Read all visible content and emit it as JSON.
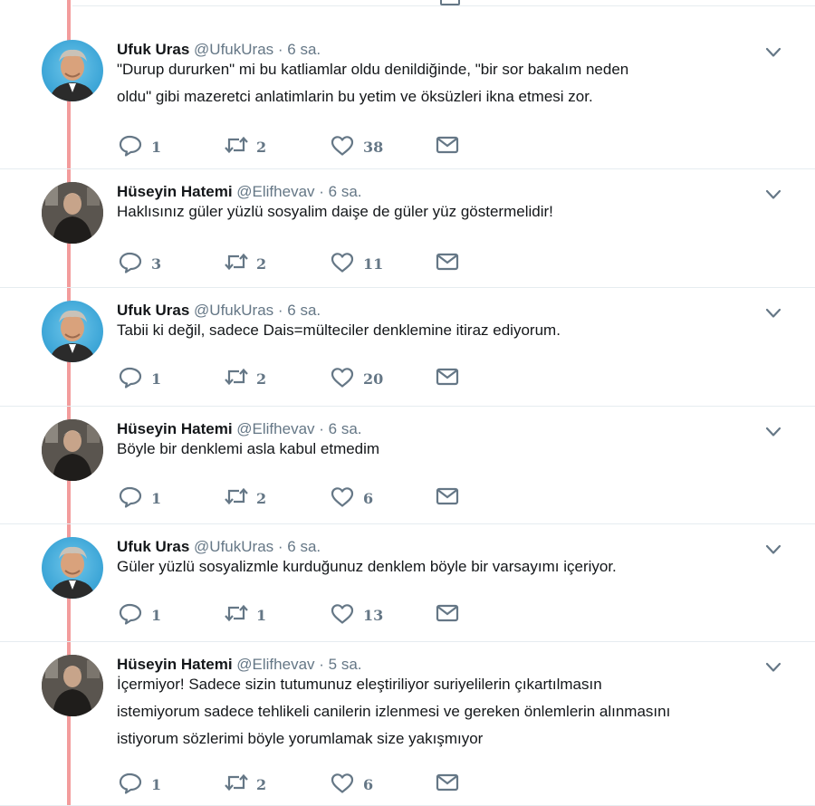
{
  "colors": {
    "thread_line": "#f39c9c",
    "secondary_text": "#657786",
    "primary_text": "#14171a",
    "divider": "#e6ecf0"
  },
  "icons": {
    "reply": "reply-icon",
    "retweet": "retweet-icon",
    "like": "heart-icon",
    "dm": "envelope-icon",
    "menu": "chevron-down-icon"
  },
  "tweets": [
    {
      "name": "Ufuk Uras",
      "handle": "@UfukUras",
      "separator": "·",
      "time": "6 sa.",
      "text": "\"Durup dururken\" mi bu katliamlar oldu  denildiğinde, \"bir sor bakalım neden\noldu\" gibi mazeretci anlatimlarin bu yetim ve öksüzleri ikna etmesi zor.",
      "replies": "1",
      "retweets": "2",
      "likes": "38"
    },
    {
      "name": "Hüseyin Hatemi",
      "handle": "@Elifhevav",
      "separator": "·",
      "time": "6 sa.",
      "text": "Haklısınız güler yüzlü sosyalim daişe de güler yüz göstermelidir!",
      "replies": "3",
      "retweets": "2",
      "likes": "11"
    },
    {
      "name": "Ufuk Uras",
      "handle": "@UfukUras",
      "separator": "·",
      "time": "6 sa.",
      "text": "Tabii ki değil, sadece Dais=mülteciler denklemine itiraz ediyorum.",
      "replies": "1",
      "retweets": "2",
      "likes": "20"
    },
    {
      "name": "Hüseyin Hatemi",
      "handle": "@Elifhevav",
      "separator": "·",
      "time": "6 sa.",
      "text": "Böyle bir denklemi asla kabul etmedim",
      "replies": "1",
      "retweets": "2",
      "likes": "6"
    },
    {
      "name": "Ufuk Uras",
      "handle": "@UfukUras",
      "separator": "·",
      "time": "6 sa.",
      "text": "Güler yüzlü sosyalizmle kurduğunuz denklem böyle bir varsayımı içeriyor.",
      "replies": "1",
      "retweets": "1",
      "likes": "13"
    },
    {
      "name": "Hüseyin Hatemi",
      "handle": "@Elifhevav",
      "separator": "·",
      "time": "5 sa.",
      "text": "İçermiyor! Sadece sizin tutumunuz eleştiriliyor suriyelilerin çıkartılmasın\nistemiyorum sadece tehlikeli canilerin izlenmesi ve gereken önlemlerin alınmasını\nistiyorum sözlerimi böyle yorumlamak size yakışmıyor",
      "replies": "1",
      "retweets": "2",
      "likes": "6"
    }
  ]
}
